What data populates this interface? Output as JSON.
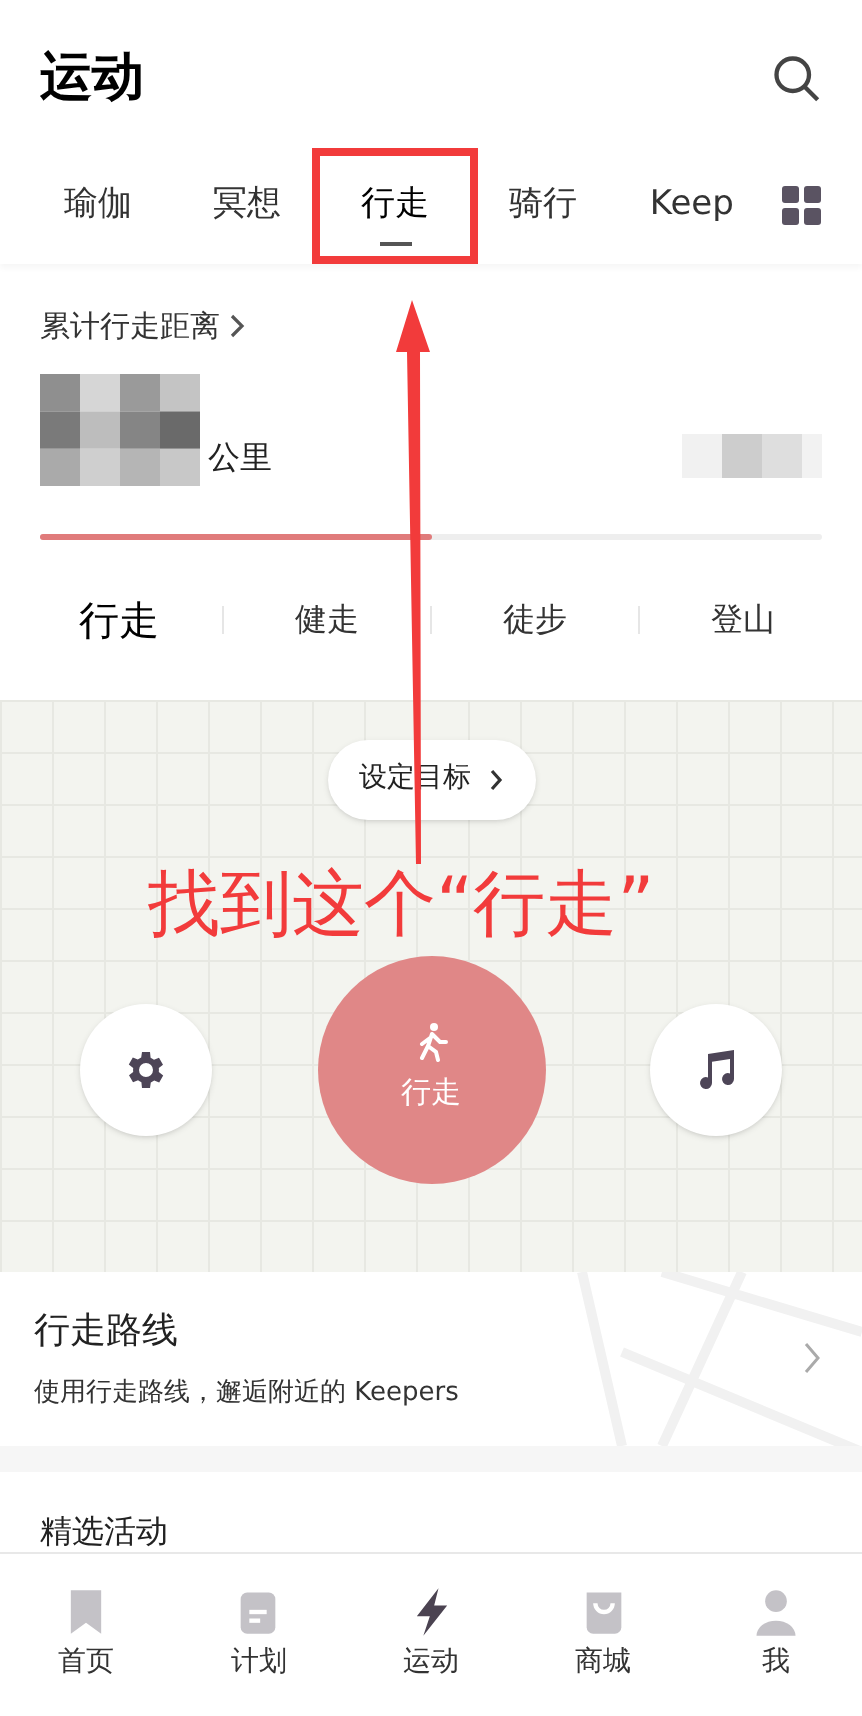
{
  "header": {
    "title": "运动"
  },
  "tabs": [
    {
      "label": "瑜伽",
      "selected": false,
      "highlighted": false
    },
    {
      "label": "冥想",
      "selected": false,
      "highlighted": false
    },
    {
      "label": "行走",
      "selected": true,
      "highlighted": true
    },
    {
      "label": "骑行",
      "selected": false,
      "highlighted": false
    },
    {
      "label": "Keep",
      "selected": false,
      "highlighted": false
    }
  ],
  "distance": {
    "title": "累计行走距离",
    "unit": "公里",
    "level": 0.5
  },
  "modes": [
    {
      "label": "行走",
      "selected": true
    },
    {
      "label": "健走",
      "selected": false
    },
    {
      "label": "徒步",
      "selected": false
    },
    {
      "label": "登山",
      "selected": false
    }
  ],
  "map": {
    "goal_button": "设定目标",
    "start_button": "行走"
  },
  "annotation": {
    "text": "找到这个“行走”"
  },
  "route_card": {
    "title": "行走路线",
    "subtitle": "使用行走路线，邂逅附近的 Keepers"
  },
  "featured": {
    "title": "精选活动"
  },
  "nav": [
    {
      "label": "首页",
      "kind": "bookmark",
      "selected": false
    },
    {
      "label": "计划",
      "kind": "plan",
      "selected": false
    },
    {
      "label": "运动",
      "kind": "bolt",
      "selected": true
    },
    {
      "label": "商城",
      "kind": "bag",
      "selected": false
    },
    {
      "label": "我",
      "kind": "person",
      "selected": false
    }
  ]
}
